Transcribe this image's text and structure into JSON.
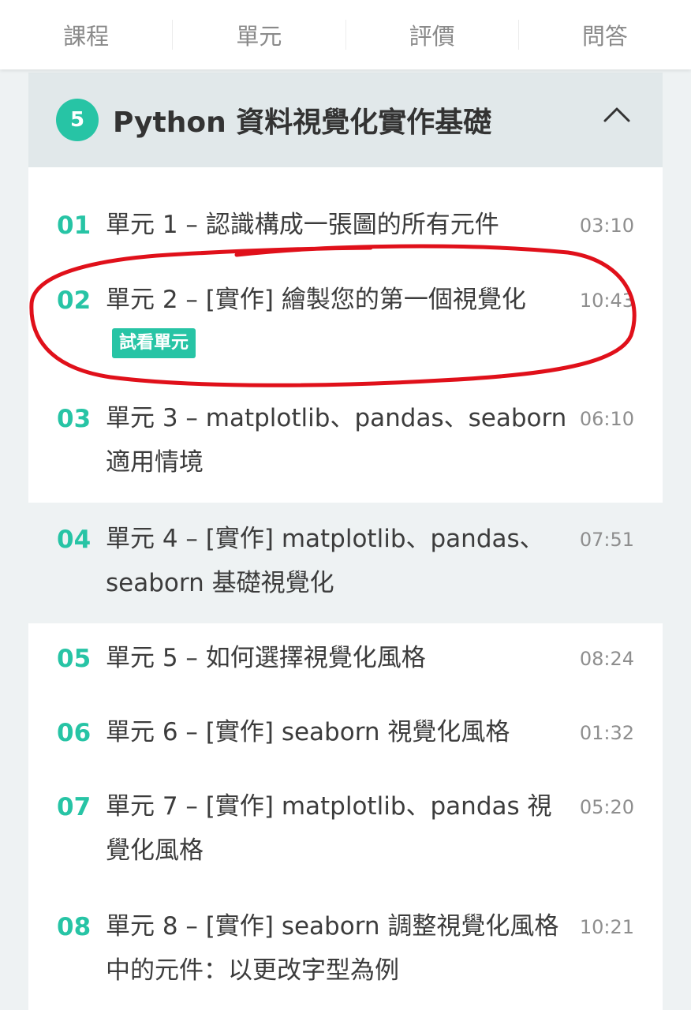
{
  "tabs": [
    {
      "label": "課程"
    },
    {
      "label": "單元"
    },
    {
      "label": "評價"
    },
    {
      "label": "問答"
    }
  ],
  "section": {
    "number": "5",
    "title": "Python 資料視覺化實作基礎",
    "toggle_icon": "chevron-up-icon"
  },
  "lessons": [
    {
      "num": "01",
      "title": "單元 1 – 認識構成一張圖的所有元件",
      "duration": "03:10"
    },
    {
      "num": "02",
      "title": "單元 2 – [實作] 繪製您的第一個視覺化",
      "duration": "10:43",
      "badge": "試看單元"
    },
    {
      "num": "03",
      "title": "單元 3 – matplotlib、pandas、seaborn 適用情境",
      "duration": "06:10"
    },
    {
      "num": "04",
      "title": "單元 4 – [實作] matplotlib、pandas、seaborn 基礎視覺化",
      "duration": "07:51"
    },
    {
      "num": "05",
      "title": "單元 5 – 如何選擇視覺化風格",
      "duration": "08:24"
    },
    {
      "num": "06",
      "title": "單元 6 – [實作] seaborn 視覺化風格",
      "duration": "01:32"
    },
    {
      "num": "07",
      "title": "單元 7 – [實作] matplotlib、pandas 視覺化風格",
      "duration": "05:20"
    },
    {
      "num": "08",
      "title": "單元 8 – [實作] seaborn 調整視覺化風格中的元件：以更改字型為例",
      "duration": "10:21"
    }
  ],
  "colors": {
    "accent": "#27c4a5",
    "annotation": "#e0101a",
    "header_bg": "#e1e8ea"
  }
}
